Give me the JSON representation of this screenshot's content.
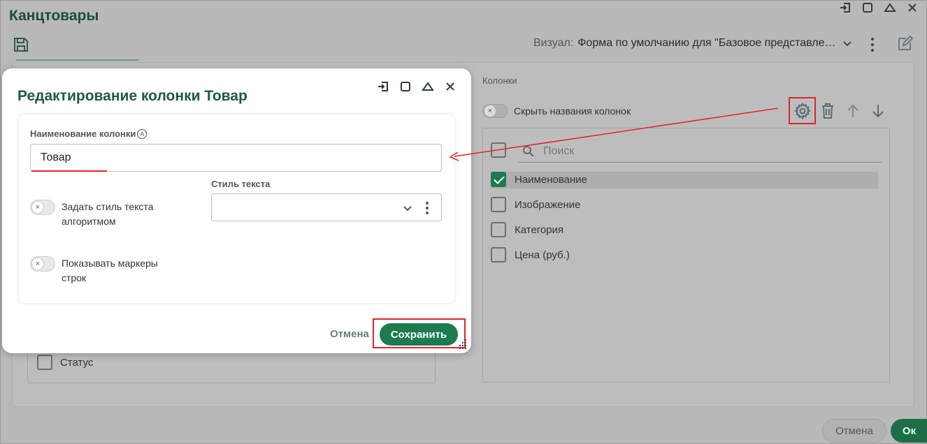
{
  "window": {
    "title": "Канцтовары",
    "controls": [
      "pin-icon",
      "maximize-icon",
      "collapse-icon",
      "close-icon"
    ]
  },
  "toolbar": {
    "visual_label": "Визуал:",
    "visual_value": "Форма по умолчанию для \"Базовое представле…"
  },
  "columns_panel": {
    "section_label": "Колонки",
    "hide_names_label": "Скрыть названия колонок",
    "search_placeholder": "Поиск",
    "items": [
      {
        "label": "Наименование",
        "checked": true
      },
      {
        "label": "Изображение",
        "checked": false
      },
      {
        "label": "Категория",
        "checked": false
      },
      {
        "label": "Цена (руб.)",
        "checked": false
      }
    ]
  },
  "left_panel": {
    "status_label": "Статус"
  },
  "footer": {
    "cancel_label": "Отмена",
    "ok_label": "Ок"
  },
  "modal": {
    "title": "Редактирование колонки Товар",
    "column_name_label": "Наименование колонки",
    "column_name_value": "Товар",
    "algo_style_label": "Задать стиль текста алгоритмом",
    "row_markers_label": "Показывать маркеры строк",
    "text_style_label": "Стиль текста",
    "text_style_value": "",
    "cancel_label": "Отмена",
    "save_label": "Сохранить"
  },
  "colors": {
    "accent_green": "#1b7c50",
    "annotation_red": "#e0242c",
    "title_green": "#1f5a3f"
  }
}
